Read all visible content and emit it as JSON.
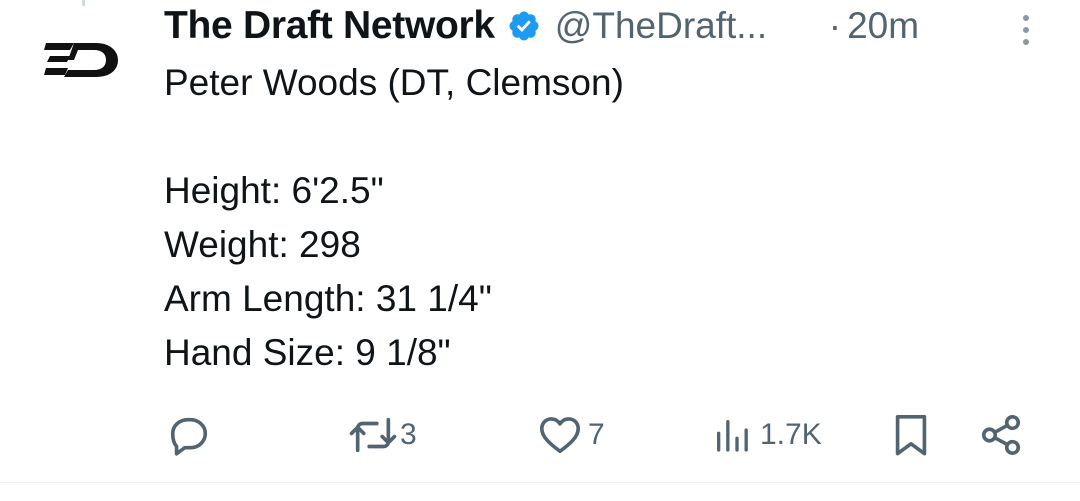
{
  "tweet": {
    "author_name": "The Draft Network",
    "handle": "@TheDraft...",
    "separator": "·",
    "time": "20m",
    "avatar_icon": "draft-network-logo",
    "verified_icon": "verified-badge-icon",
    "body_lines": [
      "Peter Woods (DT, Clemson)",
      "",
      "Height: 6'2.5\"",
      "Weight: 298",
      "Arm Length: 31 1/4\"",
      "Hand Size: 9 1/8\""
    ]
  },
  "actions": {
    "reply": {
      "icon": "reply-icon",
      "count": ""
    },
    "retweet": {
      "icon": "retweet-icon",
      "count": "3"
    },
    "like": {
      "icon": "heart-icon",
      "count": "7"
    },
    "views": {
      "icon": "views-icon",
      "count": "1.7K"
    },
    "bookmark": {
      "icon": "bookmark-icon"
    },
    "share": {
      "icon": "share-icon"
    }
  },
  "colors": {
    "text_primary": "#0f1419",
    "text_secondary": "#536471",
    "verified_blue": "#1d9bf0"
  }
}
